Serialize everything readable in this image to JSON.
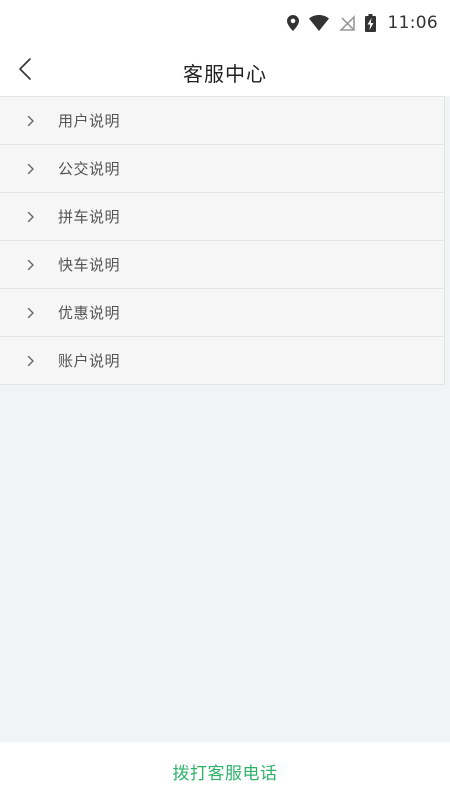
{
  "status_bar": {
    "time": "11:06",
    "icons": [
      "location-icon",
      "wifi-icon",
      "no-sim-icon",
      "battery-charging-icon"
    ]
  },
  "header": {
    "title": "客服中心",
    "back_icon": "chevron-left-icon"
  },
  "menu": {
    "items": [
      {
        "label": "用户说明",
        "icon": "chevron-right-icon"
      },
      {
        "label": "公交说明",
        "icon": "chevron-right-icon"
      },
      {
        "label": "拼车说明",
        "icon": "chevron-right-icon"
      },
      {
        "label": "快车说明",
        "icon": "chevron-right-icon"
      },
      {
        "label": "优惠说明",
        "icon": "chevron-right-icon"
      },
      {
        "label": "账户说明",
        "icon": "chevron-right-icon"
      }
    ]
  },
  "footer": {
    "call_label": "拨打客服电话"
  },
  "colors": {
    "accent": "#2fb36b",
    "content_bg": "#f2f3f5",
    "list_bg": "#f6f6f6",
    "divider": "#e3e3e3"
  }
}
